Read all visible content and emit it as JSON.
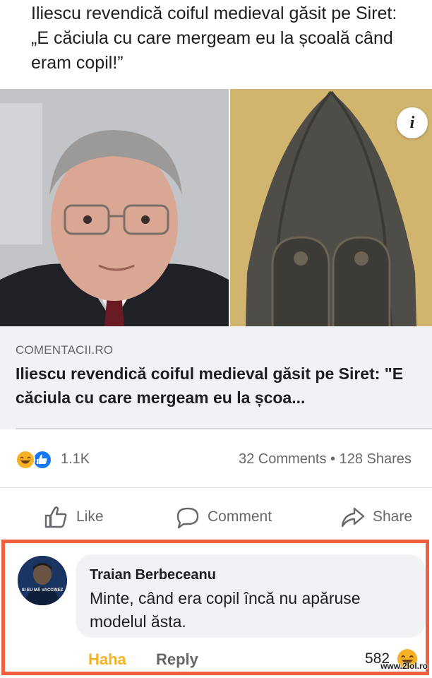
{
  "post": {
    "text": "Iliescu revendică coiful medieval găsit pe Siret: „E căciula cu care mergeam eu la școală când eram copil!”"
  },
  "media": {
    "info_badge": "i"
  },
  "link_card": {
    "source": "COMENTACII.RO",
    "title": "Iliescu revendică coiful medieval găsit pe Siret: \"E căciula cu care mergeam eu la școa..."
  },
  "stats": {
    "reaction_count": "1.1K",
    "comments_shares": "32 Comments • 128 Shares",
    "reaction_icons": [
      "haha-icon",
      "like-icon"
    ]
  },
  "actions": {
    "like": "Like",
    "comment": "Comment",
    "share": "Share"
  },
  "comment": {
    "author": "Traian Berbeceanu",
    "text": "Minte, când era copil încă nu apăruse modelul ăsta.",
    "avatar_text": "SI EU MĂ VACCINEZ",
    "reaction_label": "Haha",
    "reply_label": "Reply",
    "reaction_count": "582"
  },
  "watermark": "www.2lol.ro",
  "colors": {
    "accent": "#1877f2",
    "haha": "#f7b125",
    "highlight_frame": "#f0603e",
    "muted_text": "#65676b"
  }
}
